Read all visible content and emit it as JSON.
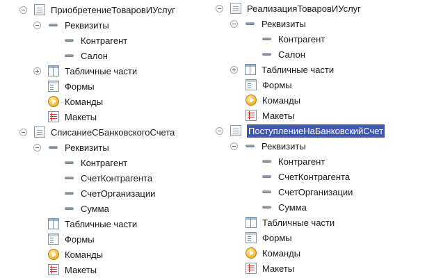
{
  "left_tree": [
    {
      "name": "ПриобретениеТоваровИУслуг",
      "requisites_label": "Реквизиты",
      "requisites": [
        "Контрагент",
        "Салон"
      ],
      "tabular_label": "Табличные части",
      "forms_label": "Формы",
      "commands_label": "Команды",
      "templates_label": "Макеты"
    },
    {
      "name": "СписаниеСБанковскогоСчета",
      "requisites_label": "Реквизиты",
      "requisites": [
        "Контрагент",
        "СчетКонтрагента",
        "СчетОрганизации",
        "Сумма"
      ],
      "tabular_label": "Табличные части",
      "forms_label": "Формы",
      "commands_label": "Команды",
      "templates_label": "Макеты"
    }
  ],
  "right_tree": [
    {
      "name": "РеализацияТоваровИУслуг",
      "requisites_label": "Реквизиты",
      "requisites": [
        "Контрагент",
        "Салон"
      ],
      "tabular_label": "Табличные части",
      "forms_label": "Формы",
      "commands_label": "Команды",
      "templates_label": "Макеты"
    },
    {
      "name": "ПоступлениеНаБанковскийСчет",
      "selected": true,
      "requisites_label": "Реквизиты",
      "requisites": [
        "Контрагент",
        "СчетКонтрагента",
        "СчетОрганизации",
        "Сумма"
      ],
      "tabular_label": "Табличные части",
      "forms_label": "Формы",
      "commands_label": "Команды",
      "templates_label": "Макеты"
    }
  ],
  "colors": {
    "selection": "#3f58b8"
  }
}
